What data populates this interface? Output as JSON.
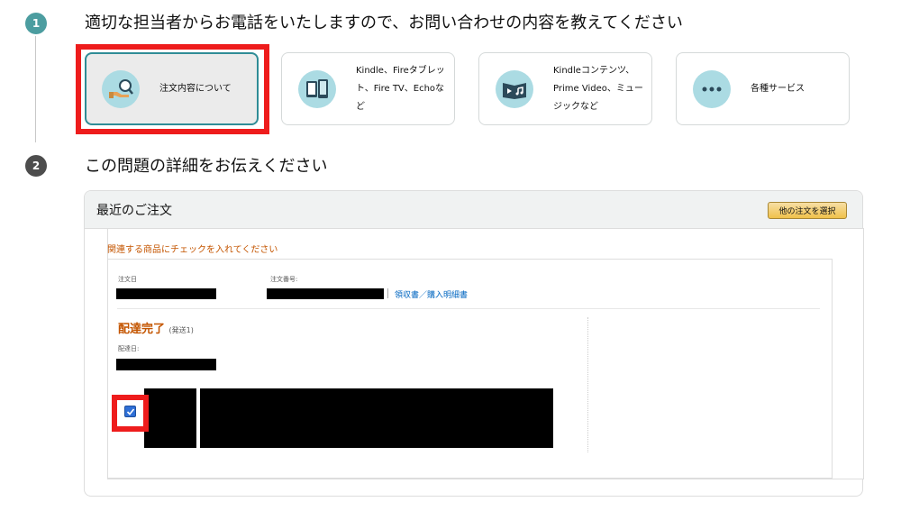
{
  "steps": [
    {
      "number": "1",
      "heading": "適切な担当者からお電話をいたしますので、お問い合わせの内容を教えてください"
    },
    {
      "number": "2",
      "heading": "この問題の詳細をお伝えください"
    }
  ],
  "topics": [
    {
      "label": "注文内容について",
      "icon": "hand-magnifier-icon",
      "selected": true
    },
    {
      "label": "Kindle、Fireタブレット、Fire TV、Echoなど",
      "icon": "devices-icon",
      "selected": false
    },
    {
      "label": "Kindleコンテンツ、Prime Video、ミュージックなど",
      "icon": "media-icon",
      "selected": false
    },
    {
      "label": "各種サービス",
      "icon": "more-dots-icon",
      "selected": false
    }
  ],
  "order_panel": {
    "title": "最近のご注文",
    "other_orders_button": "他の注文を選択",
    "instruction": "関連する商品にチェックを入れてください",
    "order_date_label": "注文日",
    "order_number_label": "注文番号:",
    "receipt_link": "領収書／購入明細書",
    "delivery_status": "配達完了",
    "shipment_label": "(発送1)",
    "delivery_date_label": "配達日:",
    "item_checked": true
  },
  "colors": {
    "accent_teal": "#4c9da0",
    "highlight_red": "#ee1c1c",
    "status_orange": "#c45500",
    "link_blue": "#0066c0"
  }
}
